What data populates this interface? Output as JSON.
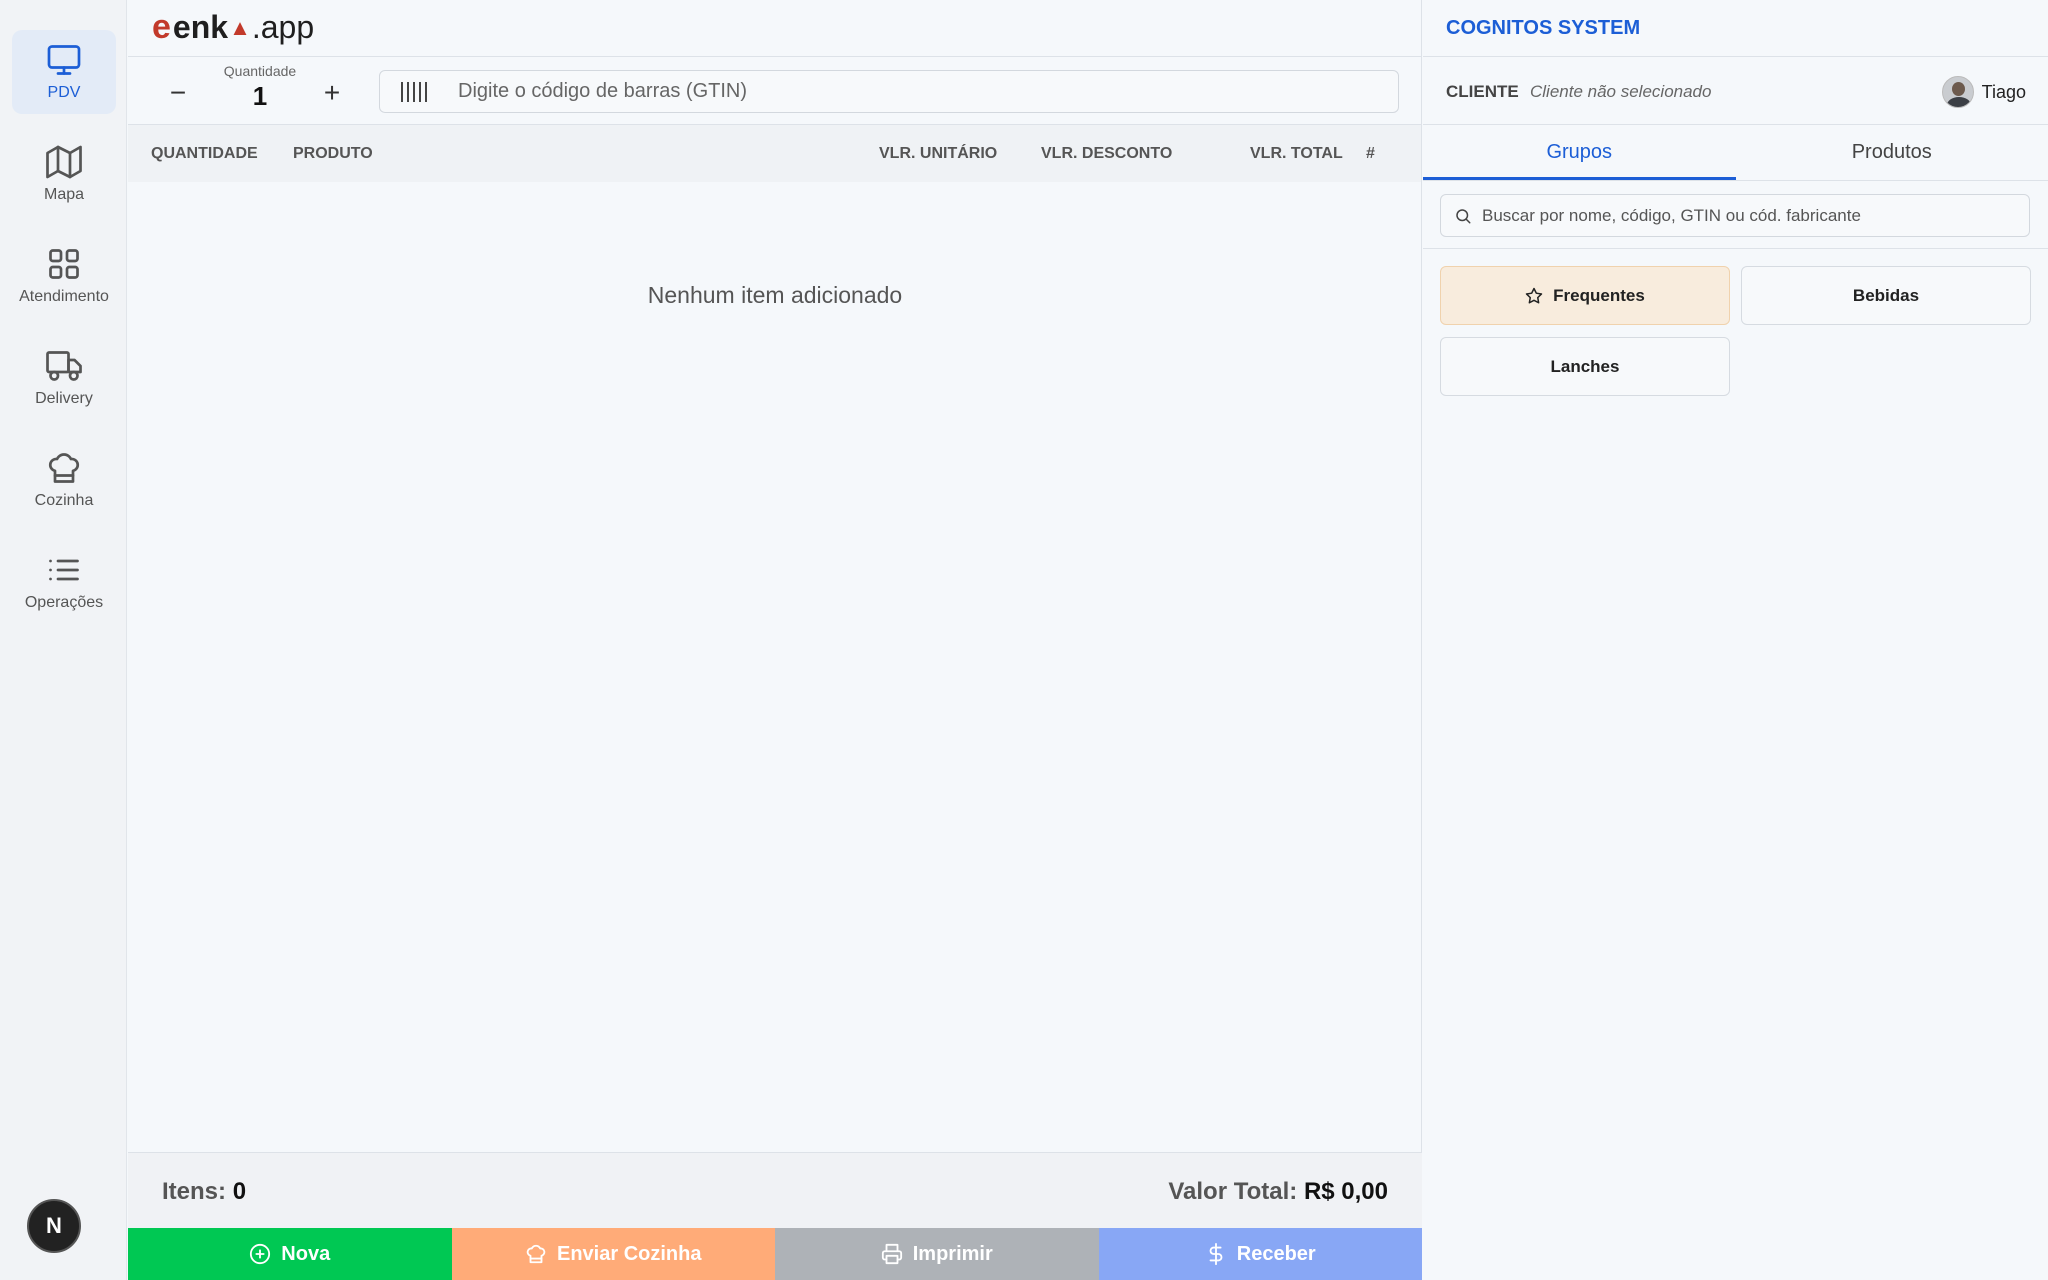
{
  "sidebar": {
    "items": [
      {
        "label": "PDV",
        "icon": "monitor-icon",
        "active": true
      },
      {
        "label": "Mapa",
        "icon": "map-icon"
      },
      {
        "label": "Atendimento",
        "icon": "grid-icon"
      },
      {
        "label": "Delivery",
        "icon": "truck-icon"
      },
      {
        "label": "Cozinha",
        "icon": "chef-hat-icon"
      },
      {
        "label": "Operações",
        "icon": "list-icon"
      }
    ],
    "badge": "N"
  },
  "header": {
    "logo_mark": "e",
    "logo_enk": "enk",
    "logo_suffix": ".app"
  },
  "quantity": {
    "label": "Quantidade",
    "value": "1",
    "minus": "−",
    "plus": "+"
  },
  "barcode": {
    "placeholder": "Digite o código de barras (GTIN)"
  },
  "table": {
    "columns": [
      "QUANTIDADE",
      "PRODUTO",
      "VLR. UNITÁRIO",
      "VLR. DESCONTO",
      "VLR. TOTAL",
      "#"
    ],
    "empty": "Nenhum item adicionado"
  },
  "footer": {
    "items_label": "Itens:",
    "items_value": "0",
    "total_label": "Valor Total:",
    "total_value": "R$ 0,00"
  },
  "actions": {
    "nova": "Nova",
    "cozinha": "Enviar Cozinha",
    "imprimir": "Imprimir",
    "receber": "Receber"
  },
  "right": {
    "company": "COGNITOS SYSTEM",
    "client_label": "CLIENTE",
    "client_value": "Cliente não selecionado",
    "user": "Tiago",
    "tabs": [
      "Grupos",
      "Produtos"
    ],
    "search_placeholder": "Buscar por nome, código, GTIN ou cód. fabricante",
    "groups": [
      "Frequentes",
      "Bebidas",
      "Lanches"
    ]
  },
  "colors": {
    "accent": "#1c5ed6",
    "nova": "#00c853",
    "cozinha": "#ffab78",
    "imprimir": "#aeb2b7",
    "receber": "#88a7f5"
  }
}
